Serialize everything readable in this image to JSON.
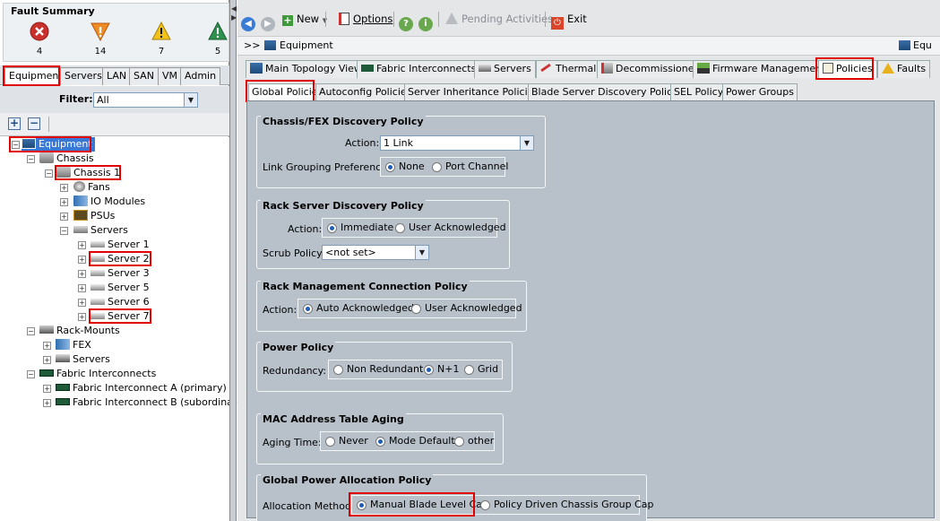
{
  "fault_summary": {
    "title": "Fault Summary",
    "items": [
      {
        "icon": "critical-x-icon",
        "count": "4",
        "color": "#d43a2f"
      },
      {
        "icon": "major-triangle-down-icon",
        "count": "14",
        "color": "#f08a24"
      },
      {
        "icon": "minor-warning-triangle-icon",
        "count": "7",
        "color": "#f2c21b"
      },
      {
        "icon": "warning-triangle-icon",
        "count": "5",
        "color": "#2f8f4e"
      }
    ]
  },
  "left_tabs": [
    "Equipment",
    "Servers",
    "LAN",
    "SAN",
    "VM",
    "Admin"
  ],
  "filter": {
    "label": "Filter:",
    "value": "All"
  },
  "tree": {
    "equipment": "Equipment",
    "chassis": "Chassis",
    "chassis1": "Chassis 1",
    "fans": "Fans",
    "io_modules": "IO Modules",
    "psus": "PSUs",
    "servers": "Servers",
    "server1": "Server 1",
    "server2": "Server 2",
    "server3": "Server 3",
    "server5": "Server 5",
    "server6": "Server 6",
    "server7": "Server 7",
    "rack_mounts": "Rack-Mounts",
    "fex": "FEX",
    "rack_servers": "Servers",
    "fabric_interconnects": "Fabric Interconnects",
    "fi_a": "Fabric Interconnect A (primary)",
    "fi_b": "Fabric Interconnect B (subordinate)"
  },
  "toolbar": {
    "new": "New",
    "options": "Options",
    "pending": "Pending Activities",
    "exit": "Exit"
  },
  "breadcrumb": {
    "prefix": ">>",
    "path": "Equipment",
    "right": "Equ"
  },
  "main_tabs": [
    "Main Topology View",
    "Fabric Interconnects",
    "Servers",
    "Thermal",
    "Decommissioned",
    "Firmware Management",
    "Policies",
    "Faults"
  ],
  "sub_tabs": [
    "Global Policies",
    "Autoconfig Policies",
    "Server Inheritance Policies",
    "Blade Server Discovery Policies",
    "SEL Policy",
    "Power Groups"
  ],
  "policies": {
    "chassis_fex": {
      "title": "Chassis/FEX Discovery Policy",
      "action_label": "Action:",
      "action_value": "1 Link",
      "link_grouping_label": "Link Grouping Preference:",
      "opt_none": "None",
      "opt_port_channel": "Port Channel"
    },
    "rack_server": {
      "title": "Rack Server Discovery Policy",
      "action_label": "Action:",
      "opt_immediate": "Immediate",
      "opt_user_ack": "User Acknowledged",
      "scrub_label": "Scrub Policy:",
      "scrub_value": "<not set>"
    },
    "rack_mgmt": {
      "title": "Rack Management Connection Policy",
      "action_label": "Action:",
      "opt_auto_ack": "Auto Acknowledged",
      "opt_user_ack": "User Acknowledged"
    },
    "power": {
      "title": "Power Policy",
      "redundancy_label": "Redundancy:",
      "opt_non_redundant": "Non Redundant",
      "opt_n1": "N+1",
      "opt_grid": "Grid"
    },
    "mac_aging": {
      "title": "MAC Address Table Aging",
      "aging_label": "Aging Time:",
      "opt_never": "Never",
      "opt_mode_default": "Mode Default",
      "opt_other": "other"
    },
    "global_power": {
      "title": "Global Power Allocation Policy",
      "method_label": "Allocation Method:",
      "opt_manual": "Manual Blade Level Cap",
      "opt_policy": "Policy Driven Chassis Group Cap"
    }
  }
}
